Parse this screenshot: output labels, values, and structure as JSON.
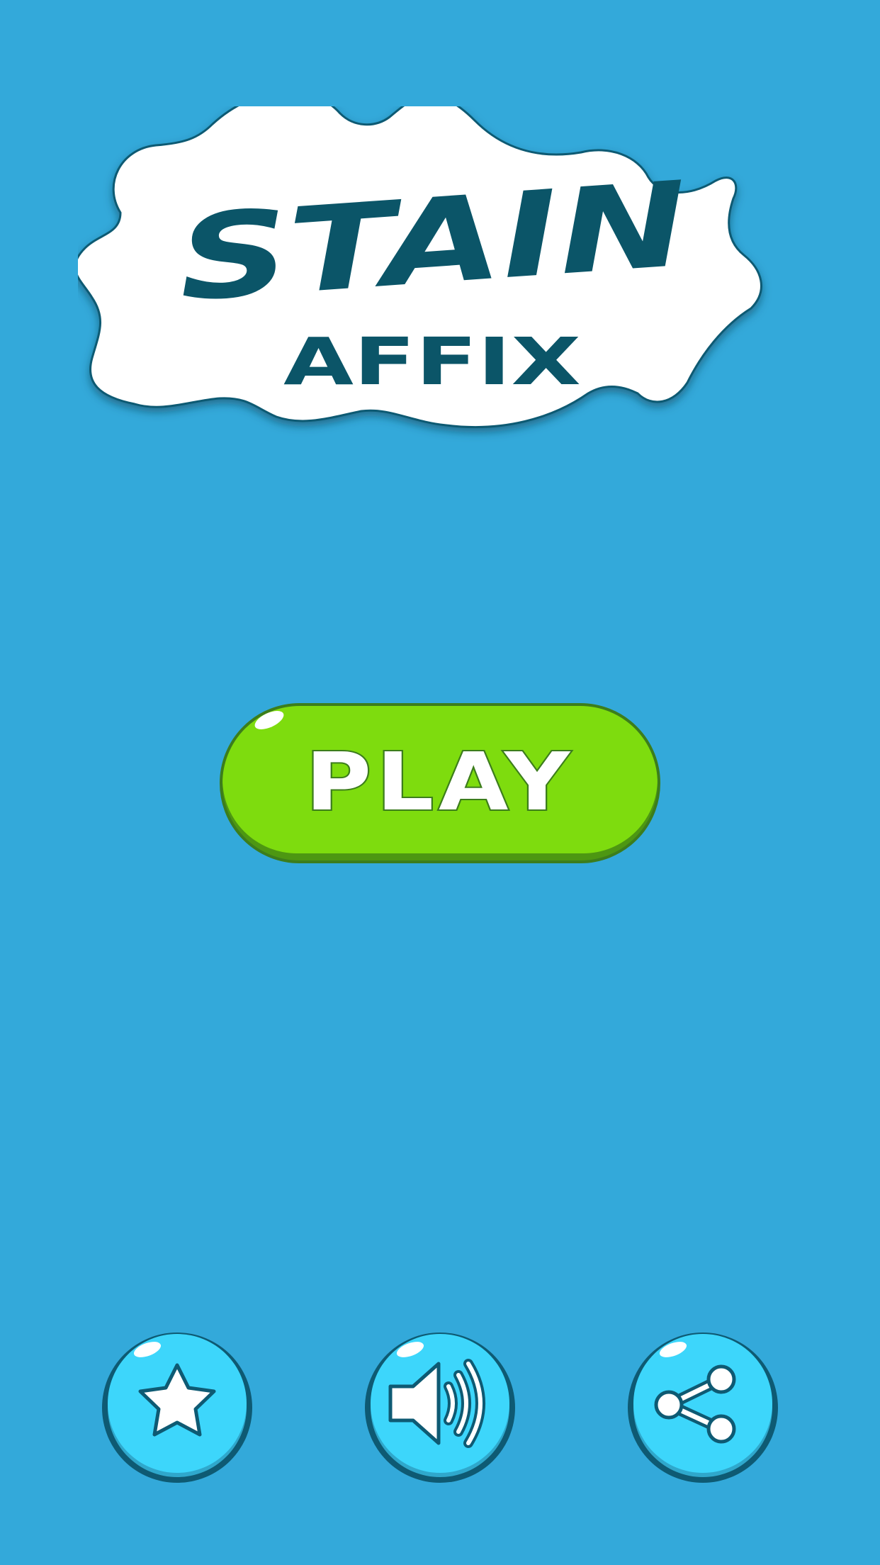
{
  "logo": {
    "title": "STAIN",
    "subtitle": "AFFIX"
  },
  "play_button": {
    "label": "PLAY"
  },
  "bottom_buttons": [
    {
      "icon": "star-icon"
    },
    {
      "icon": "speaker-icon"
    },
    {
      "icon": "share-icon"
    }
  ],
  "colors": {
    "background": "#33a9da",
    "logo_text": "#0b5568",
    "play_green": "#7edc0e",
    "round_button": "#3dd6fb",
    "outline_dark": "#0e5a73"
  }
}
